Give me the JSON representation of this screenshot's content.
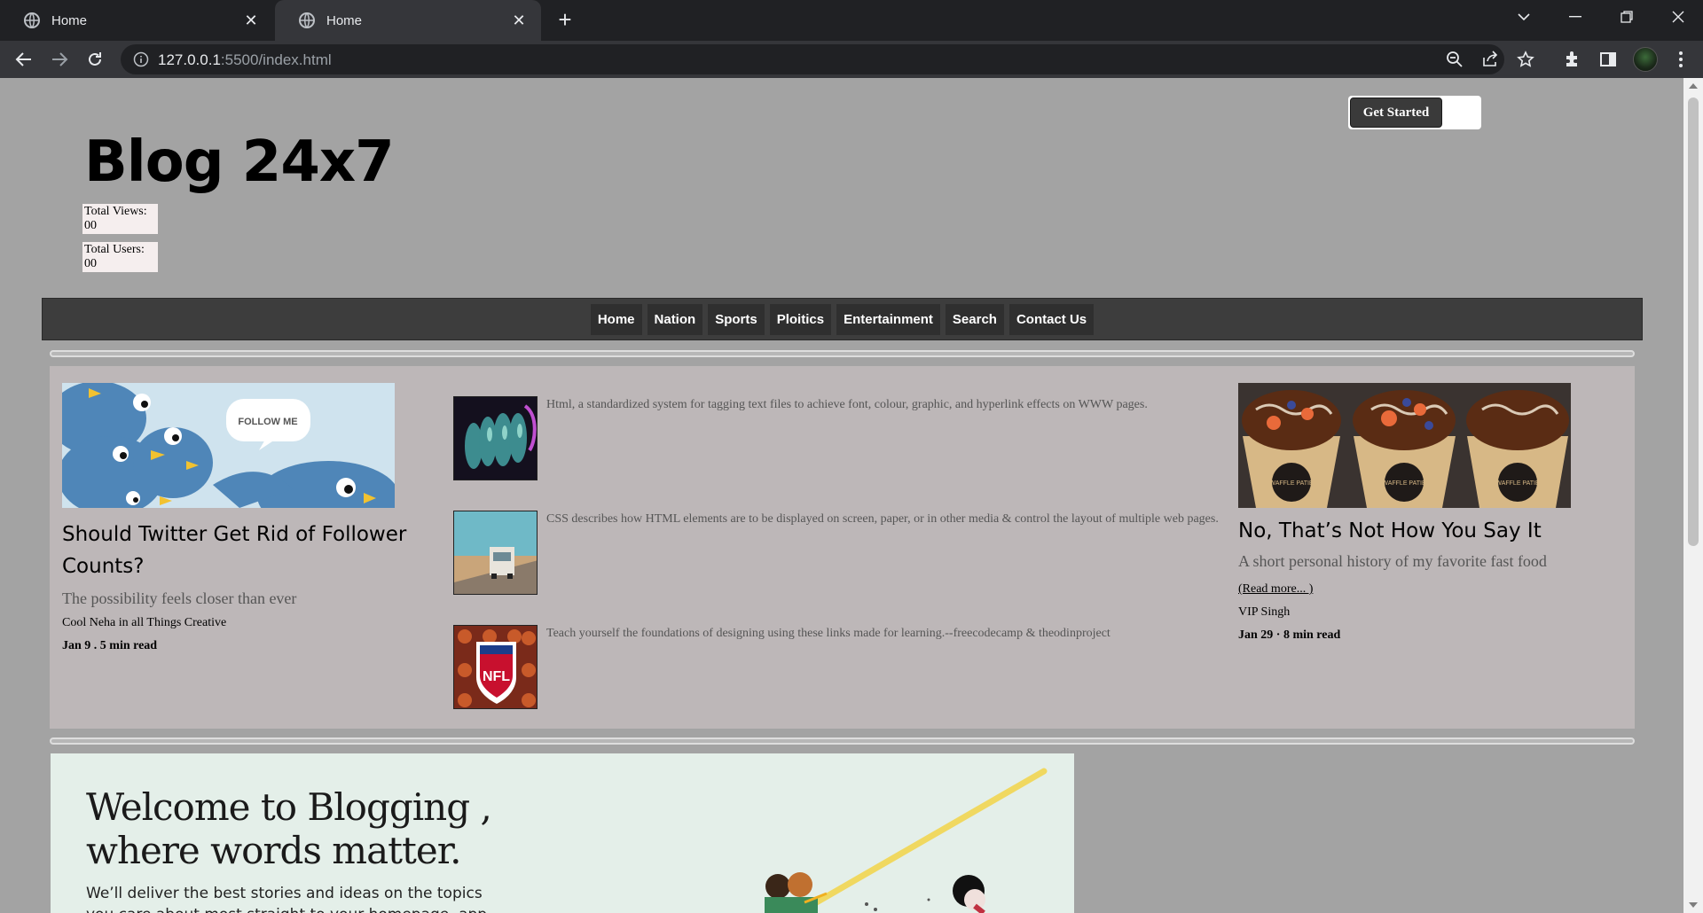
{
  "browser": {
    "tabs": [
      {
        "title": "Home"
      },
      {
        "title": "Home"
      }
    ],
    "url_host": "127.0.0.1",
    "url_rest": ":5500/index.html"
  },
  "page": {
    "get_started_label": "Get Started",
    "title": "Blog 24x7",
    "stats": [
      {
        "label": "Total Views:",
        "value": "00"
      },
      {
        "label": "Total Users:",
        "value": "00"
      }
    ],
    "nav": [
      "Home",
      "Nation",
      "Sports",
      "Ploitics",
      "Entertainment",
      "Search",
      "Contact Us"
    ],
    "left_article": {
      "image_text": "FOLLOW ME",
      "title": "Should Twitter Get Rid of Follower Counts?",
      "subtitle": "The possibility feels closer than ever",
      "author": "Cool Neha in all Things Creative",
      "meta": "Jan 9 . 5 min read"
    },
    "mid_items": [
      {
        "text": "Html, a standardized system for tagging text files to achieve font, colour, graphic, and hyperlink effects on WWW pages."
      },
      {
        "text": "CSS describes how HTML elements are to be displayed on screen, paper, or in other media & control the layout of multiple web pages."
      },
      {
        "text": "Teach yourself the foundations of designing using these links made for learning.--freecodecamp & theodinproject",
        "image_text": "NFL"
      }
    ],
    "right_article": {
      "title": "No, That’s Not How You Say It",
      "subtitle": "A short personal history of my favorite fast food",
      "read_more": "(Read more... )",
      "author": "VIP Singh",
      "meta": "Jan 29 · 8 min read",
      "image_text": "WAFFLE PATIÉ"
    },
    "welcome": {
      "heading": "Welcome to Blogging , where words matter.",
      "body": "We’ll deliver the best stories and ideas on the topics you care about most straight to your homepage, app, or inbox."
    }
  }
}
